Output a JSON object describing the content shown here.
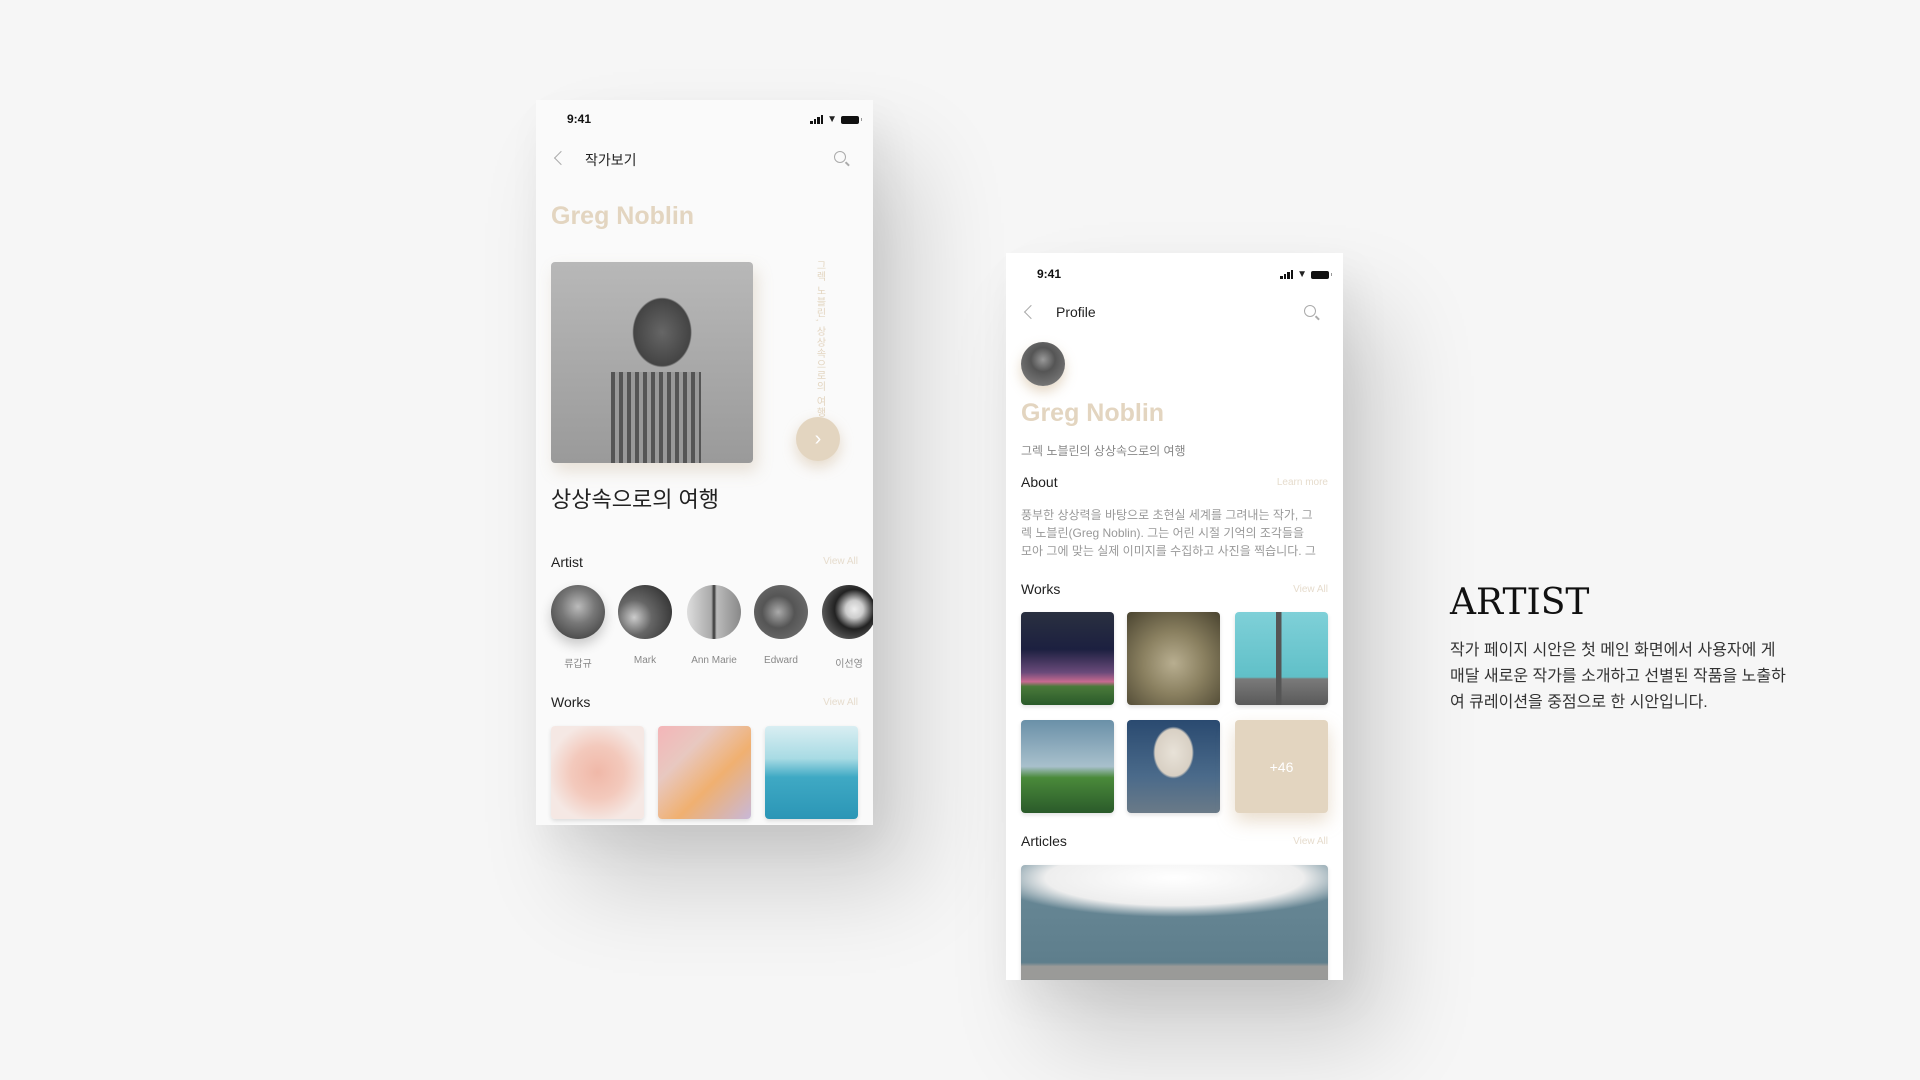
{
  "screen1": {
    "status_time": "9:41",
    "nav_title": "작가보기",
    "artist_name": "Greg Noblin",
    "vertical_caption": "그렉 노블린, 상상속으로의 여행",
    "feature_title": "상상속으로의 여행",
    "artist_section": {
      "title": "Artist",
      "view_all": "View All",
      "artists": [
        {
          "name": "류갑규"
        },
        {
          "name": "Mark"
        },
        {
          "name": "Ann Marie"
        },
        {
          "name": "Edward"
        },
        {
          "name": "이선영"
        }
      ]
    },
    "works_section": {
      "title": "Works",
      "view_all": "View All"
    }
  },
  "screen2": {
    "status_time": "9:41",
    "nav_title": "Profile",
    "artist_name": "Greg Noblin",
    "subtitle": "그렉 노블린의 상상속으로의 여행",
    "about": {
      "title": "About",
      "learn_more": "Learn more",
      "lines": [
        "풍부한 상상력을 바탕으로 초현실 세계를 그려내는 작가, 그",
        "렉 노블린(Greg Noblin). 그는 어린 시절 기억의 조각들을",
        "모아 그에 맞는 실제 이미지를 수집하고 사진을 찍습니다. 그"
      ]
    },
    "works": {
      "title": "Works",
      "view_all": "View All",
      "more_count": "+46"
    },
    "articles": {
      "title": "Articles",
      "view_all": "View All"
    }
  },
  "description": {
    "heading": "ARTIST",
    "lines": [
      "작가 페이지 시안은 첫 메인 화면에서 사용자에 게",
      "매달 새로운 작가를 소개하고 선별된 작품을 노출하",
      "여 큐레이션을 중점으로 한 시안입니다."
    ]
  },
  "colors": {
    "accent": "#e3d5c0",
    "background": "#f6f6f6"
  }
}
